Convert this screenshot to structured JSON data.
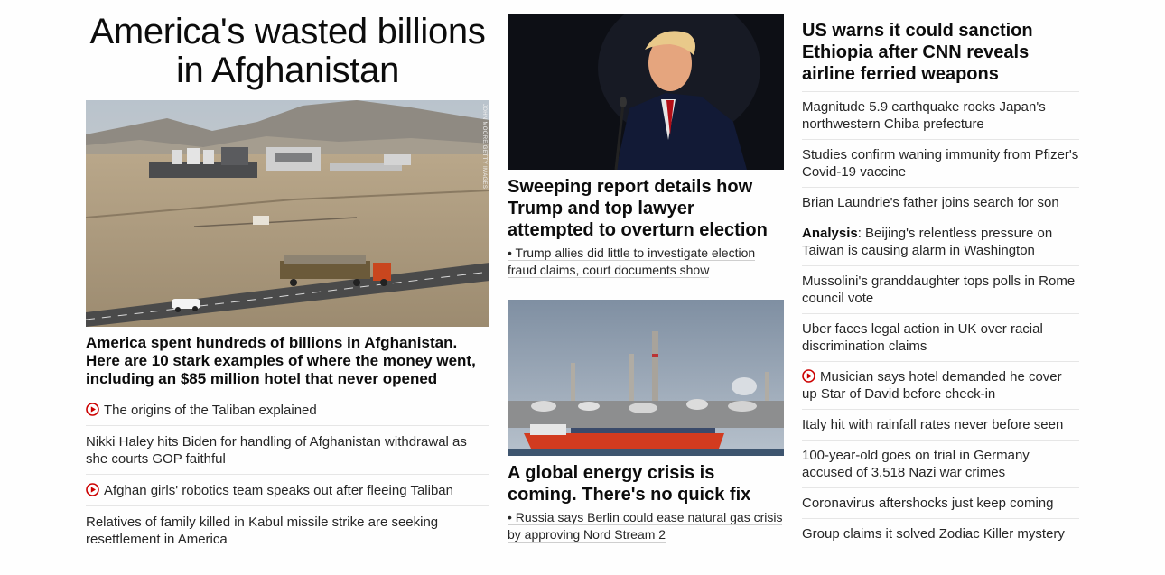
{
  "left": {
    "banner": "America's wasted billions in Afghanistan",
    "hero_credit": "JOHN MOORE/GETTY IMAGES",
    "hero_caption": "America spent hundreds of billions in Afghanistan. Here are 10 stark examples of where the money went, including an $85 million hotel that never opened",
    "items": [
      {
        "text": "The origins of the Taliban explained",
        "video": true
      },
      {
        "text": "Nikki Haley hits Biden for handling of Afghanistan withdrawal as she courts GOP faithful",
        "video": false
      },
      {
        "text": "Afghan girls' robotics team speaks out after fleeing Taliban",
        "video": true
      },
      {
        "text": "Relatives of family killed in Kabul missile strike are seeking resettlement in America",
        "video": false
      }
    ]
  },
  "middle": {
    "story1": {
      "headline": "Sweeping report details how Trump and top lawyer attempted to overturn election",
      "sub": "• Trump allies did little to investigate election fraud claims, court documents show"
    },
    "story2": {
      "headline": "A global energy crisis is coming. There's no quick fix",
      "sub": "• Russia says Berlin could ease natural gas crisis by approving Nord Stream 2"
    }
  },
  "right": {
    "headline": "US warns it could sanction Ethiopia after CNN reveals airline ferried weapons",
    "items": [
      {
        "text": "Magnitude 5.9 earthquake rocks Japan's northwestern Chiba prefecture"
      },
      {
        "text": "Studies confirm waning immunity from Pfizer's Covid-19 vaccine"
      },
      {
        "text": "Brian Laundrie's father joins search for son"
      },
      {
        "prefix": "Analysis",
        "text": ": Beijing's relentless pressure on Taiwan is causing alarm in Washington"
      },
      {
        "text": "Mussolini's granddaughter tops polls in Rome council vote"
      },
      {
        "text": "Uber faces legal action in UK over racial discrimination claims"
      },
      {
        "text": "Musician says hotel demanded he cover up Star of David before check-in",
        "video": true
      },
      {
        "text": "Italy hit with rainfall rates never before seen"
      },
      {
        "text": "100-year-old goes on trial in Germany accused of 3,518 Nazi war crimes"
      },
      {
        "text": "Coronavirus aftershocks just keep coming"
      },
      {
        "text": "Group claims it solved Zodiac Killer mystery"
      }
    ]
  },
  "colors": {
    "video_icon": "#cc0000",
    "divider": "#e6e6e6",
    "headline": "#0c0c0c",
    "body_text": "#262626"
  }
}
